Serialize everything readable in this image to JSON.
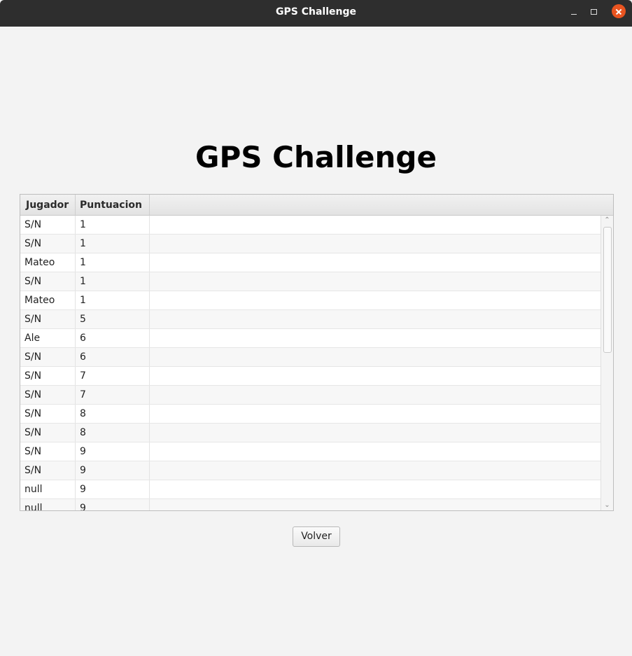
{
  "window": {
    "title": "GPS Challenge"
  },
  "header": {
    "title": "GPS Challenge"
  },
  "table": {
    "columns": [
      "Jugador",
      "Puntuacion"
    ],
    "rows": [
      {
        "jugador": "S/N",
        "puntuacion": "1"
      },
      {
        "jugador": "S/N",
        "puntuacion": "1"
      },
      {
        "jugador": "Mateo",
        "puntuacion": "1"
      },
      {
        "jugador": "S/N",
        "puntuacion": "1"
      },
      {
        "jugador": "Mateo",
        "puntuacion": "1"
      },
      {
        "jugador": "S/N",
        "puntuacion": "5"
      },
      {
        "jugador": "Ale",
        "puntuacion": "6"
      },
      {
        "jugador": "S/N",
        "puntuacion": "6"
      },
      {
        "jugador": "S/N",
        "puntuacion": "7"
      },
      {
        "jugador": "S/N",
        "puntuacion": "7"
      },
      {
        "jugador": "S/N",
        "puntuacion": "8"
      },
      {
        "jugador": "S/N",
        "puntuacion": "8"
      },
      {
        "jugador": "S/N",
        "puntuacion": "9"
      },
      {
        "jugador": "S/N",
        "puntuacion": "9"
      },
      {
        "jugador": "null",
        "puntuacion": "9"
      },
      {
        "jugador": "null",
        "puntuacion": "9"
      }
    ]
  },
  "actions": {
    "back_label": "Volver"
  },
  "icons": {
    "minimize": "minimize-icon",
    "maximize": "maximize-icon",
    "close": "close-icon",
    "scroll_up": "chevron-up-icon",
    "scroll_down": "chevron-down-icon"
  },
  "colors": {
    "titlebar": "#2e2e2e",
    "close_button": "#e95420",
    "background": "#f3f3f3"
  }
}
